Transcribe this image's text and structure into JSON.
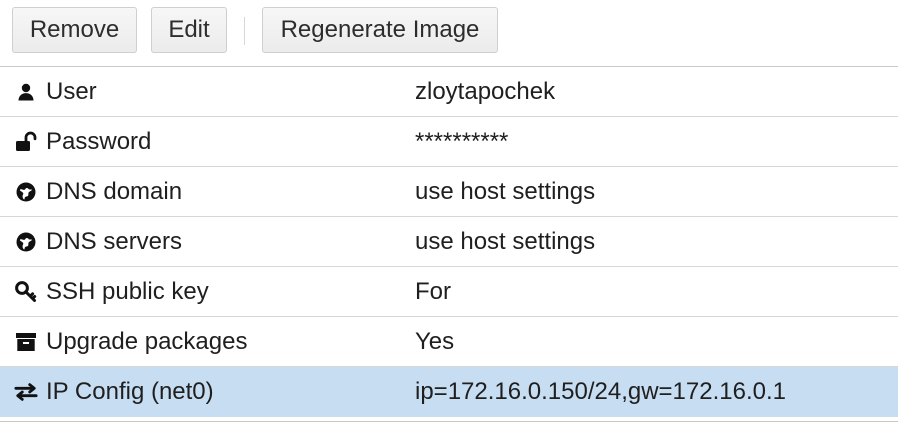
{
  "toolbar": {
    "remove_label": "Remove",
    "edit_label": "Edit",
    "regenerate_label": "Regenerate Image"
  },
  "rows": [
    {
      "icon": "user-icon",
      "label": "User",
      "value": "zloytapochek"
    },
    {
      "icon": "unlock-icon",
      "label": "Password",
      "value": "**********"
    },
    {
      "icon": "globe-icon",
      "label": "DNS domain",
      "value": "use host settings"
    },
    {
      "icon": "globe-icon",
      "label": "DNS servers",
      "value": "use host settings"
    },
    {
      "icon": "key-icon",
      "label": "SSH public key",
      "value": "For"
    },
    {
      "icon": "archive-icon",
      "label": "Upgrade packages",
      "value": "Yes"
    },
    {
      "icon": "exchange-icon",
      "label": "IP Config (net0)",
      "value": "ip=172.16.0.150/24,gw=172.16.0.1"
    }
  ],
  "colors": {
    "selected_row": "#c7ddf2",
    "button_border": "#cfcfcf",
    "text": "#1f1f1f"
  }
}
